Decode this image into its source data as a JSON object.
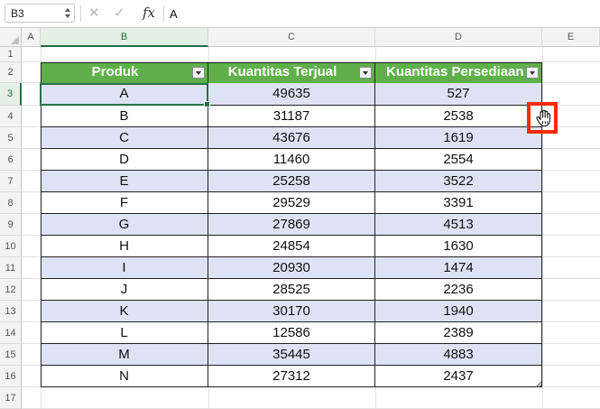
{
  "formula_bar": {
    "name_box": "B3",
    "fx_label": "fx",
    "content": "A"
  },
  "columns": [
    "A",
    "B",
    "C",
    "D",
    "E"
  ],
  "rows": [
    "1",
    "2",
    "3",
    "4",
    "5",
    "6",
    "7",
    "8",
    "9",
    "10",
    "11",
    "12",
    "13",
    "14",
    "15",
    "16",
    "17"
  ],
  "selected_column": "B",
  "selected_row": "3",
  "table": {
    "headers": [
      "Produk",
      "Kuantitas Terjual",
      "Kuantitas Persediaan"
    ],
    "header_color": "#5fb04a",
    "band_color": "#dde3f4",
    "rows": [
      [
        "A",
        "49635",
        "527"
      ],
      [
        "B",
        "31187",
        "2538"
      ],
      [
        "C",
        "43676",
        "1619"
      ],
      [
        "D",
        "11460",
        "2554"
      ],
      [
        "E",
        "25258",
        "3522"
      ],
      [
        "F",
        "29529",
        "3391"
      ],
      [
        "G",
        "27869",
        "4513"
      ],
      [
        "H",
        "24854",
        "1630"
      ],
      [
        "I",
        "20930",
        "1474"
      ],
      [
        "J",
        "28525",
        "2236"
      ],
      [
        "K",
        "30170",
        "1940"
      ],
      [
        "L",
        "12586",
        "2389"
      ],
      [
        "M",
        "35445",
        "4883"
      ],
      [
        "N",
        "27312",
        "2437"
      ]
    ]
  },
  "highlight_color": "#ff2a00"
}
